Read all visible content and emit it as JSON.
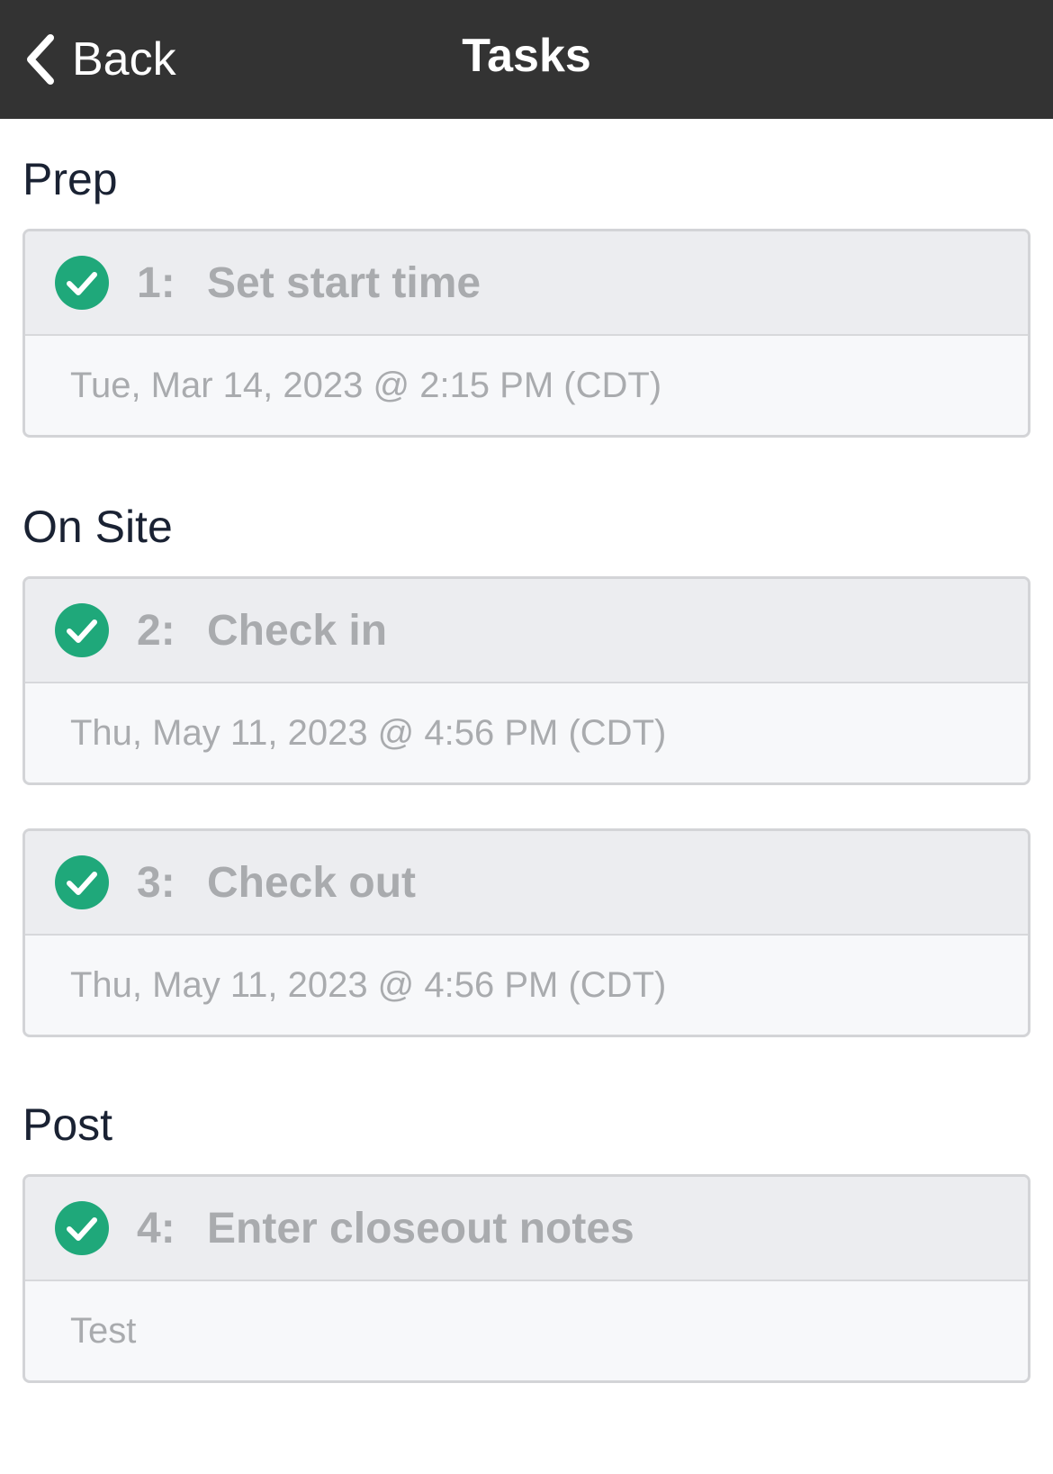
{
  "navbar": {
    "back_label": "Back",
    "title": "Tasks"
  },
  "colors": {
    "navbar_bg": "#333333",
    "check_green": "#1fa87a",
    "muted_text": "#a9abae"
  },
  "sections": [
    {
      "title": "Prep",
      "tasks": [
        {
          "number": "1:",
          "name": "Set start time",
          "detail": "Tue, Mar 14, 2023 @ 2:15 PM (CDT)",
          "status_icon": "check-circle-icon"
        }
      ]
    },
    {
      "title": "On Site",
      "tasks": [
        {
          "number": "2:",
          "name": "Check in",
          "detail": "Thu, May 11, 2023 @ 4:56 PM (CDT)",
          "status_icon": "check-circle-icon"
        },
        {
          "number": "3:",
          "name": "Check out",
          "detail": "Thu, May 11, 2023 @ 4:56 PM (CDT)",
          "status_icon": "check-circle-icon"
        }
      ]
    },
    {
      "title": "Post",
      "tasks": [
        {
          "number": "4:",
          "name": "Enter closeout notes",
          "detail": "Test",
          "status_icon": "check-circle-icon"
        }
      ]
    }
  ]
}
